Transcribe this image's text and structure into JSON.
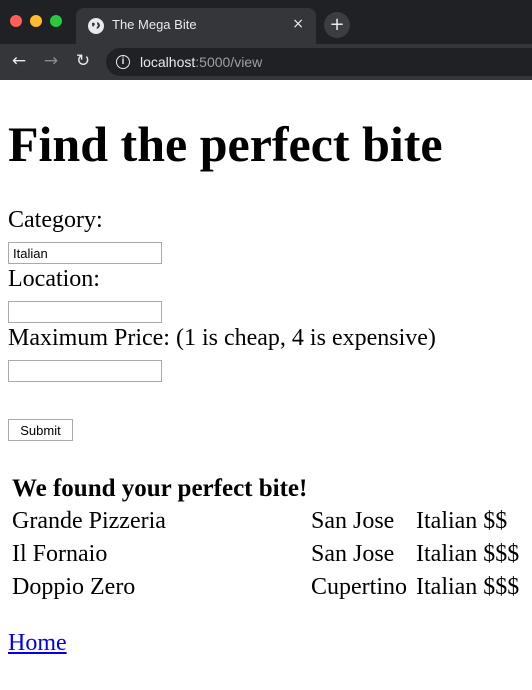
{
  "browser": {
    "tab_title": "The Mega Bite",
    "tab_close": "×",
    "new_tab": "+",
    "url_host": "localhost",
    "url_rest": ":5000/view",
    "back": "←",
    "forward": "→",
    "reload": "↻"
  },
  "page": {
    "heading": "Find the perfect bite",
    "form": {
      "category_label": "Category:",
      "category_value": "Italian",
      "location_label": "Location:",
      "location_value": "",
      "price_label": "Maximum Price: (1 is cheap, 4 is expensive)",
      "price_value": "",
      "submit_label": "Submit"
    },
    "results_heading": "We found your perfect bite!",
    "results": [
      {
        "name": "Grande Pizzeria",
        "location": "San Jose",
        "category_price": "Italian $$"
      },
      {
        "name": "Il Fornaio",
        "location": "San Jose",
        "category_price": "Italian $$$"
      },
      {
        "name": "Doppio Zero",
        "location": "Cupertino",
        "category_price": "Italian $$$"
      }
    ],
    "home_link": "Home"
  }
}
